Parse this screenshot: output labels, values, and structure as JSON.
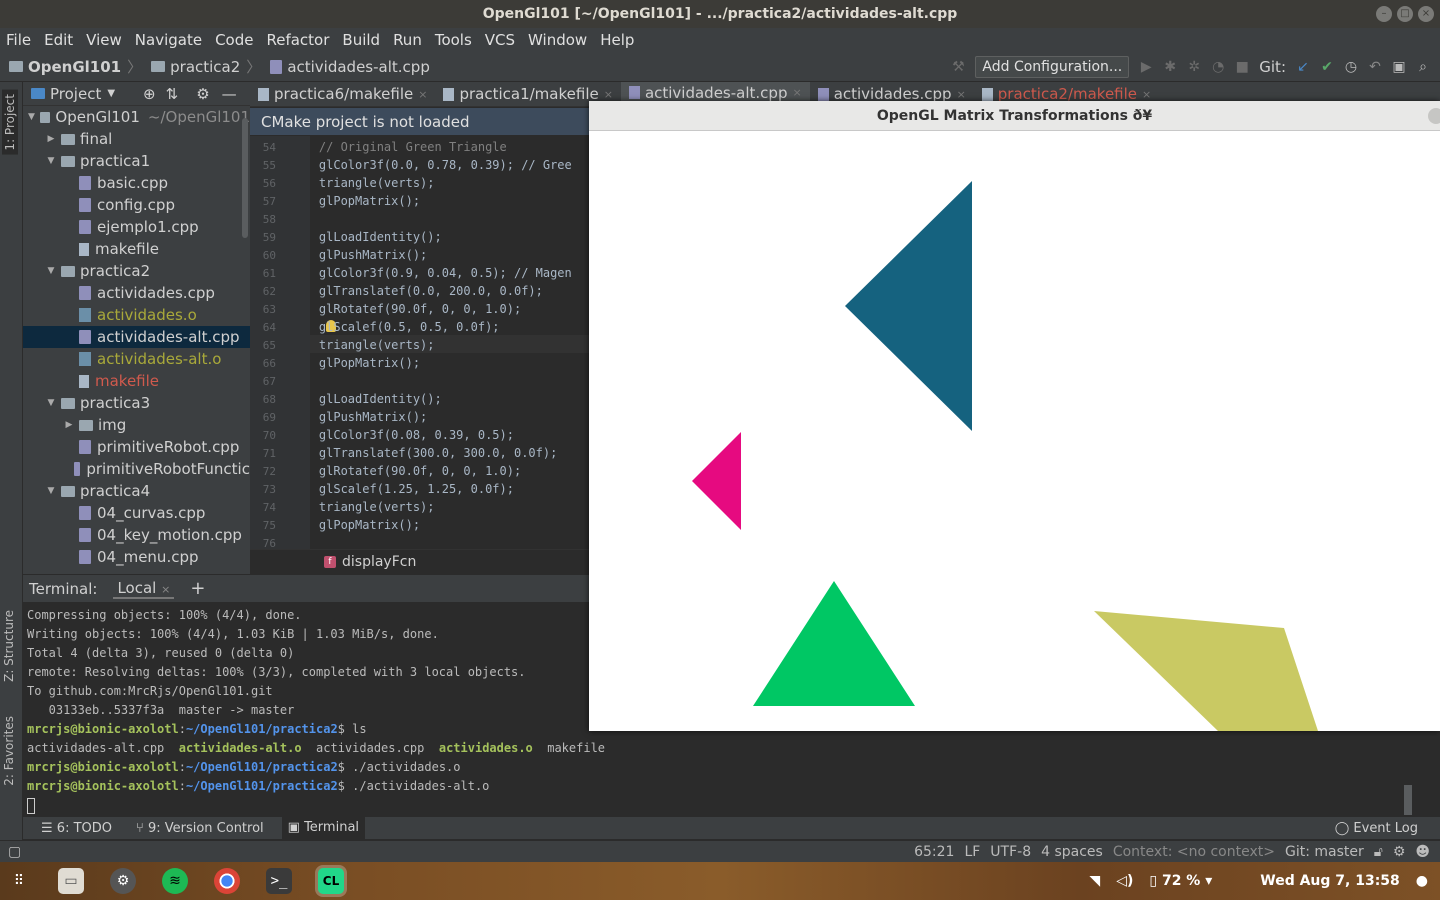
{
  "window": {
    "title": "OpenGl101 [~/OpenGl101] - .../practica2/actividades-alt.cpp"
  },
  "menu": [
    "File",
    "Edit",
    "View",
    "Navigate",
    "Code",
    "Refactor",
    "Build",
    "Run",
    "Tools",
    "VCS",
    "Window",
    "Help"
  ],
  "breadcrumbs": [
    "OpenGl101",
    "practica2",
    "actividades-alt.cpp"
  ],
  "toolbar": {
    "add_configuration": "Add Configuration...",
    "git_label": "Git:"
  },
  "side_tabs": {
    "project": "1: Project",
    "structure": "Z: Structure",
    "favorites": "2: Favorites"
  },
  "project_panel": {
    "title": "Project",
    "tree": [
      {
        "name": "OpenGl101",
        "path": "~/OpenGl101",
        "type": "folder",
        "depth": 0,
        "open": true
      },
      {
        "name": "final",
        "type": "folder",
        "depth": 1,
        "open": false
      },
      {
        "name": "practica1",
        "type": "folder",
        "depth": 1,
        "open": true
      },
      {
        "name": "basic.cpp",
        "type": "cpp",
        "depth": 2
      },
      {
        "name": "config.cpp",
        "type": "cpp",
        "depth": 2
      },
      {
        "name": "ejemplo1.cpp",
        "type": "cpp",
        "depth": 2
      },
      {
        "name": "makefile",
        "type": "make",
        "depth": 2
      },
      {
        "name": "practica2",
        "type": "folder",
        "depth": 1,
        "open": true
      },
      {
        "name": "actividades.cpp",
        "type": "cpp",
        "depth": 2
      },
      {
        "name": "actividades.o",
        "type": "obj",
        "depth": 2,
        "color": "olive"
      },
      {
        "name": "actividades-alt.cpp",
        "type": "cpp",
        "depth": 2,
        "selected": true
      },
      {
        "name": "actividades-alt.o",
        "type": "obj",
        "depth": 2,
        "color": "olive"
      },
      {
        "name": "makefile",
        "type": "make",
        "depth": 2,
        "color": "red"
      },
      {
        "name": "practica3",
        "type": "folder",
        "depth": 1,
        "open": true
      },
      {
        "name": "img",
        "type": "folder",
        "depth": 2,
        "open": false
      },
      {
        "name": "primitiveRobot.cpp",
        "type": "cpp",
        "depth": 2
      },
      {
        "name": "primitiveRobotFunctic",
        "type": "cpp",
        "depth": 2
      },
      {
        "name": "practica4",
        "type": "folder",
        "depth": 1,
        "open": true
      },
      {
        "name": "04_curvas.cpp",
        "type": "cpp",
        "depth": 2
      },
      {
        "name": "04_key_motion.cpp",
        "type": "cpp",
        "depth": 2
      },
      {
        "name": "04_menu.cpp",
        "type": "cpp",
        "depth": 2
      }
    ]
  },
  "tabs": [
    {
      "label": "practica6/makefile",
      "active": false
    },
    {
      "label": "practica1/makefile",
      "active": false
    },
    {
      "label": "actividades-alt.cpp",
      "active": true
    },
    {
      "label": "actividades.cpp",
      "active": false
    },
    {
      "label": "practica2/makefile",
      "active": false,
      "color": "red"
    }
  ],
  "notice": "CMake project is not loaded",
  "code_lines": [
    {
      "n": "54",
      "t": "    // Original Green Triangle"
    },
    {
      "n": "55",
      "t": "    glColor3f(0.0, 0.78, 0.39); // Gree"
    },
    {
      "n": "56",
      "t": "    triangle(verts);"
    },
    {
      "n": "57",
      "t": "    glPopMatrix();"
    },
    {
      "n": "58",
      "t": ""
    },
    {
      "n": "59",
      "t": "    glLoadIdentity();"
    },
    {
      "n": "60",
      "t": "    glPushMatrix();"
    },
    {
      "n": "61",
      "t": "    glColor3f(0.9, 0.04, 0.5); // Magen"
    },
    {
      "n": "62",
      "t": "    glTranslatef(0.0, 200.0, 0.0f);"
    },
    {
      "n": "63",
      "t": "    glRotatef(90.0f, 0, 0, 1.0);"
    },
    {
      "n": "64",
      "t": "    glScalef(0.5, 0.5, 0.0f);"
    },
    {
      "n": "65",
      "t": "    triangle(verts);"
    },
    {
      "n": "66",
      "t": "    glPopMatrix();"
    },
    {
      "n": "67",
      "t": ""
    },
    {
      "n": "68",
      "t": "    glLoadIdentity();"
    },
    {
      "n": "69",
      "t": "    glPushMatrix();"
    },
    {
      "n": "70",
      "t": "    glColor3f(0.08, 0.39, 0.5);"
    },
    {
      "n": "71",
      "t": "    glTranslatef(300.0, 300.0, 0.0f);"
    },
    {
      "n": "72",
      "t": "    glRotatef(90.0f, 0, 0, 1.0);"
    },
    {
      "n": "73",
      "t": "    glScalef(1.25, 1.25, 0.0f);"
    },
    {
      "n": "74",
      "t": "    triangle(verts);"
    },
    {
      "n": "75",
      "t": "    glPopMatrix();"
    },
    {
      "n": "76",
      "t": ""
    }
  ],
  "function_crumb": "displayFcn",
  "terminal": {
    "label": "Terminal:",
    "tab": "Local",
    "lines": [
      "Compressing objects: 100% (4/4), done.",
      "Writing objects: 100% (4/4), 1.03 KiB | 1.03 MiB/s, done.",
      "Total 4 (delta 3), reused 0 (delta 0)",
      "remote: Resolving deltas: 100% (3/3), completed with 3 local objects.",
      "To github.com:MrcRjs/OpenGl101.git",
      "   03133eb..5337f3a  master -> master"
    ],
    "user": "mrcrjs@bionic-axolotl",
    "path": "~/OpenGl101/practica2",
    "cmd1": "ls",
    "ls_output": [
      "actividades-alt.cpp",
      "actividades-alt.o",
      "actividades.cpp",
      "actividades.o",
      "makefile"
    ],
    "cmd2": "./actividades.o",
    "cmd3": "./actividades-alt.o"
  },
  "bottom_tools": {
    "todo": "6: TODO",
    "vcs": "9: Version Control",
    "terminal": "Terminal",
    "event_log": "Event Log"
  },
  "status": {
    "position": "65:21",
    "line_sep": "LF",
    "encoding": "UTF-8",
    "indent": "4 spaces",
    "context": "Context: <no context>",
    "git": "Git: master"
  },
  "gl_window": {
    "title": "OpenGL Matrix Transformations ð¥",
    "triangles": [
      {
        "name": "teal",
        "color": "#15627f"
      },
      {
        "name": "magenta",
        "color": "#e60a80"
      },
      {
        "name": "green",
        "color": "#00c764"
      },
      {
        "name": "olive",
        "color": "#c9c963"
      }
    ]
  },
  "taskbar": {
    "battery": "72 %",
    "clock": "Wed Aug  7, 13:58"
  }
}
